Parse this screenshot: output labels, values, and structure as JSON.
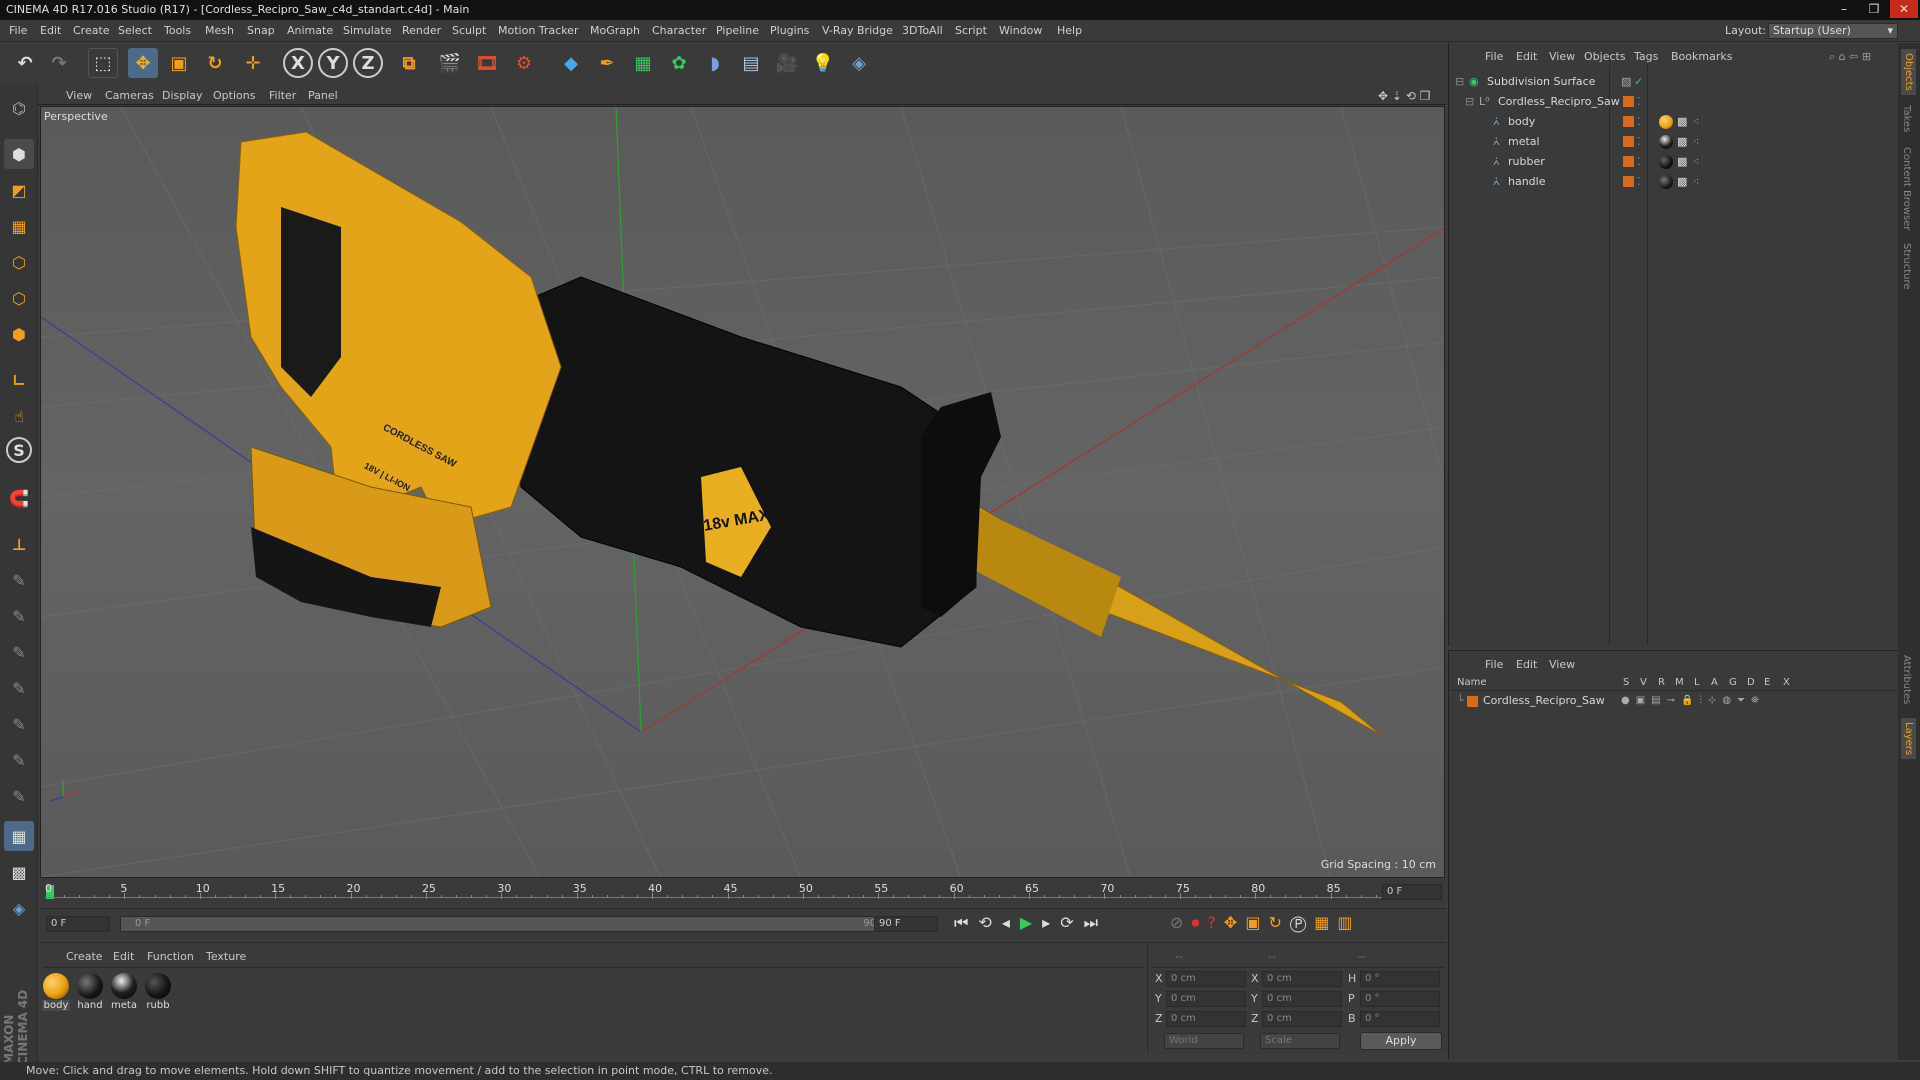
{
  "window": {
    "title": "CINEMA 4D R17.016 Studio (R17) - [Cordless_Recipro_Saw_c4d_standart.c4d] - Main"
  },
  "menubar": {
    "items": [
      "File",
      "Edit",
      "Create",
      "Select",
      "Tools",
      "Mesh",
      "Snap",
      "Animate",
      "Simulate",
      "Render",
      "Sculpt",
      "Motion Tracker",
      "MoGraph",
      "Character",
      "Pipeline",
      "Plugins",
      "V-Ray Bridge",
      "3DToAll",
      "Script",
      "Window",
      "Help"
    ],
    "layout_label": "Layout:",
    "layout_value": "Startup (User)"
  },
  "viewport": {
    "menu": [
      "View",
      "Cameras",
      "Display",
      "Options",
      "Filter",
      "Panel"
    ],
    "camera_label": "Perspective",
    "grid_spacing": "Grid Spacing : 10 cm",
    "saw_label_1": "CORDLESS SAW",
    "saw_label_2": "18V | LI-ION",
    "saw_label_3": "18v MAX"
  },
  "timeline": {
    "ticks": [
      "0",
      "5",
      "10",
      "15",
      "20",
      "25",
      "30",
      "35",
      "40",
      "45",
      "50",
      "55",
      "60",
      "65",
      "70",
      "75",
      "80",
      "85",
      "90"
    ],
    "current_frame": "0 F"
  },
  "transport": {
    "start_field": "0 F",
    "range_start": "0 F",
    "range_end": "90 F",
    "end_field": "90 F"
  },
  "materials": {
    "menu": [
      "Create",
      "Edit",
      "Function",
      "Texture"
    ],
    "items": [
      {
        "label": "body",
        "color": "#e8a010"
      },
      {
        "label": "hand",
        "color": "#1a1a1a"
      },
      {
        "label": "meta",
        "color": "#202020"
      },
      {
        "label": "rubb",
        "color": "#151515"
      }
    ]
  },
  "coordinates": {
    "headers": [
      "--",
      "--",
      "--"
    ],
    "rows": [
      {
        "a": "X",
        "av": "0 cm",
        "b": "X",
        "bv": "0 cm",
        "c": "H",
        "cv": "0 °"
      },
      {
        "a": "Y",
        "av": "0 cm",
        "b": "Y",
        "bv": "0 cm",
        "c": "P",
        "cv": "0 °"
      },
      {
        "a": "Z",
        "av": "0 cm",
        "b": "Z",
        "bv": "0 cm",
        "c": "B",
        "cv": "0 °"
      }
    ],
    "space": "World",
    "mode": "Scale",
    "apply": "Apply"
  },
  "objects": {
    "menu": [
      "File",
      "Edit",
      "View",
      "Objects",
      "Tags",
      "Bookmarks"
    ],
    "rows": [
      {
        "name": "Subdivision Surface"
      },
      {
        "name": "Cordless_Recipro_Saw"
      },
      {
        "name": "body"
      },
      {
        "name": "metal"
      },
      {
        "name": "rubber"
      },
      {
        "name": "handle"
      }
    ]
  },
  "layers": {
    "menu": [
      "File",
      "Edit",
      "View"
    ],
    "columns": [
      "Name",
      "S",
      "V",
      "R",
      "M",
      "L",
      "A",
      "G",
      "D",
      "E",
      "X"
    ],
    "rows": [
      {
        "name": "Cordless_Recipro_Saw"
      }
    ]
  },
  "right_tabs": [
    "Objects",
    "Takes",
    "Content Browser",
    "Structure",
    "Attributes",
    "Layers"
  ],
  "status": "Move: Click and drag to move elements. Hold down SHIFT to quantize movement / add to the selection in point mode, CTRL to remove.",
  "brand": "MAXON CINEMA 4D"
}
